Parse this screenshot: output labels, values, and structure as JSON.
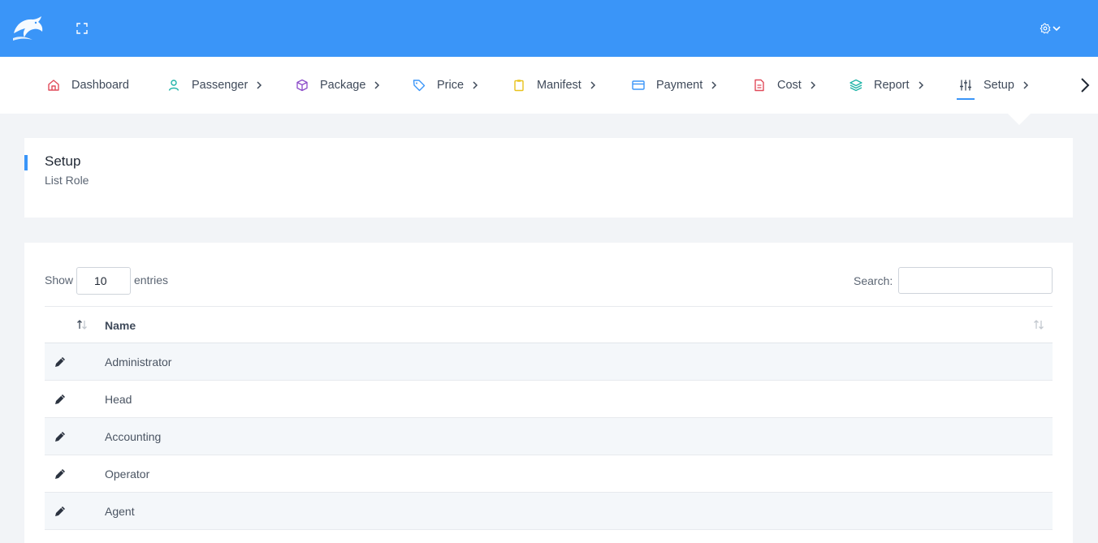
{
  "colors": {
    "primary": "#3a95f8",
    "background": "#f2f4f7",
    "card": "#ffffff"
  },
  "topbar": {
    "logo_icon": "dolphin-logo-icon",
    "fullscreen_icon": "fullscreen-icon",
    "settings_icon": "gear-icon"
  },
  "nav": {
    "items": [
      {
        "label": "Dashboard",
        "icon": "home-icon",
        "has_submenu": false
      },
      {
        "label": "Passenger",
        "icon": "user-icon",
        "has_submenu": true
      },
      {
        "label": "Package",
        "icon": "box-icon",
        "has_submenu": true
      },
      {
        "label": "Price",
        "icon": "tag-icon",
        "has_submenu": true
      },
      {
        "label": "Manifest",
        "icon": "clipboard-icon",
        "has_submenu": true
      },
      {
        "label": "Payment",
        "icon": "credit-card-icon",
        "has_submenu": true
      },
      {
        "label": "Cost",
        "icon": "document-icon",
        "has_submenu": true
      },
      {
        "label": "Report",
        "icon": "layers-icon",
        "has_submenu": true
      },
      {
        "label": "Setup",
        "icon": "sliders-icon",
        "has_submenu": true,
        "active": true
      }
    ],
    "scroll_icon": "chevron-right-icon"
  },
  "page_header": {
    "title": "Setup",
    "subtitle": "List Role"
  },
  "table_controls": {
    "show_label": "Show",
    "page_length": "10",
    "entries_label": "entries",
    "search_label": "Search:",
    "search_value": ""
  },
  "table": {
    "columns": [
      "",
      "Name"
    ],
    "rows": [
      "Administrator",
      "Head",
      "Accounting",
      "Operator",
      "Agent"
    ]
  }
}
